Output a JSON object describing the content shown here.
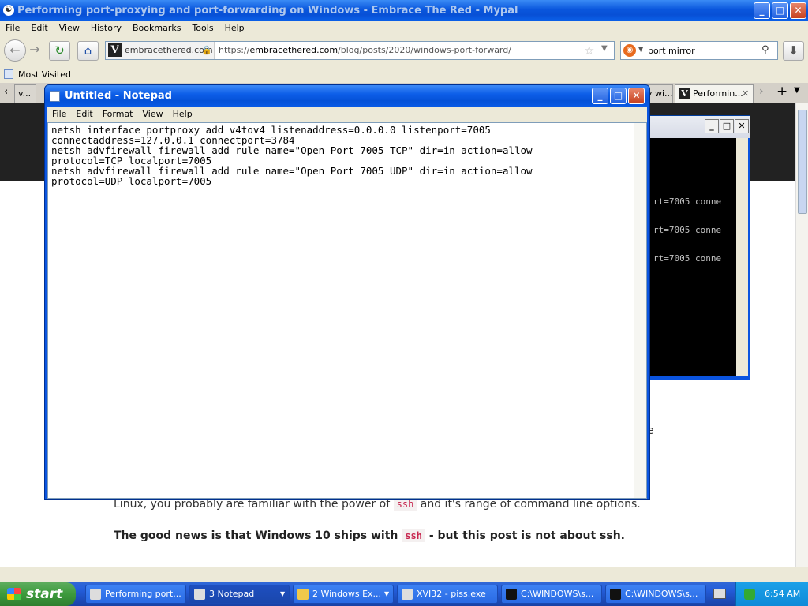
{
  "browser": {
    "title": "Performing port-proxying and port-forwarding on Windows - Embrace The Red - Mypal",
    "menu": [
      "File",
      "Edit",
      "View",
      "History",
      "Bookmarks",
      "Tools",
      "Help"
    ],
    "site_identity": "embracethered.com",
    "url_prefix": "https://",
    "url_domain": "embracethered.com",
    "url_path": "/blog/posts/2020/windows-port-forward/",
    "search_value": "port mirror",
    "bookmarks_label": "Most Visited",
    "tabs": [
      {
        "label": "v..."
      },
      {
        "label": "y wi..."
      },
      {
        "label": "Performin..."
      }
    ],
    "window_buttons": {
      "minimize": "_",
      "maximize": "□",
      "close": "✕"
    }
  },
  "page": {
    "fragment_e": "e",
    "line1_pre": "Linux, you probably are familiar with the power of",
    "line1_code": "ssh",
    "line1_post": "and it's range of command line options.",
    "line2_pre": "The good news is that Windows 10 ships with",
    "line2_code": "ssh",
    "line2_post": "- but this post is not about ssh."
  },
  "console": {
    "lines": [
      "rt=7005 conne",
      "rt=7005 conne",
      "rt=7005 conne"
    ]
  },
  "notepad": {
    "title": "Untitled - Notepad",
    "menu": [
      "File",
      "Edit",
      "Format",
      "View",
      "Help"
    ],
    "text": "netsh interface portproxy add v4tov4 listenaddress=0.0.0.0 listenport=7005\nconnectaddress=127.0.0.1 connectport=3784\nnetsh advfirewall firewall add rule name=\"Open Port 7005 TCP\" dir=in action=allow\nprotocol=TCP localport=7005\nnetsh advfirewall firewall add rule name=\"Open Port 7005 UDP\" dir=in action=allow\nprotocol=UDP localport=7005"
  },
  "taskbar": {
    "start_label": "start",
    "tasks": [
      {
        "label": "Performing port..."
      },
      {
        "label": "3 Notepad"
      },
      {
        "label": "2 Windows Ex..."
      },
      {
        "label": "XVI32 - piss.exe"
      },
      {
        "label": "C:\\WINDOWS\\s..."
      },
      {
        "label": "C:\\WINDOWS\\s..."
      }
    ],
    "clock": "6:54 AM"
  }
}
